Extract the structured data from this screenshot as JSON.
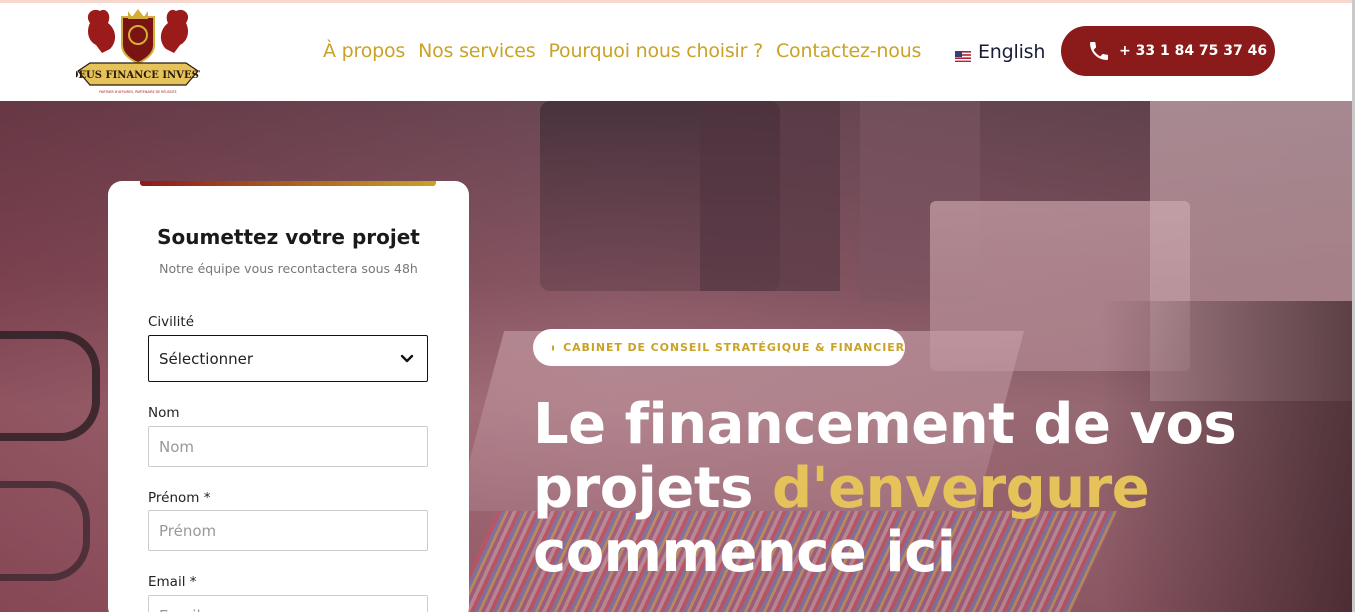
{
  "header": {
    "logo": {
      "text": "DEUS FINANCE INVEST",
      "tagline": "PARTNER D'AFFAIRES, PARTENAIRE DE RÉUSSITE"
    },
    "nav": [
      {
        "label": "À propos"
      },
      {
        "label": "Nos services"
      },
      {
        "label": "Pourquoi nous choisir ?"
      },
      {
        "label": "Contactez-nous"
      }
    ],
    "language": {
      "label": "English",
      "icon": "us-flag-icon"
    },
    "phone": {
      "label": "+ 33 1 84 75 37 46",
      "icon": "phone-icon"
    }
  },
  "form": {
    "title": "Soumettez votre projet",
    "subtitle": "Notre équipe vous recontactera sous 48h",
    "civilite": {
      "label": "Civilité",
      "value": "Sélectionner"
    },
    "nom": {
      "label": "Nom",
      "placeholder": "Nom"
    },
    "prenom": {
      "label": "Prénom *",
      "placeholder": "Prénom"
    },
    "email": {
      "label": "Email *",
      "placeholder": "Email"
    }
  },
  "hero": {
    "badge": "CABINET DE CONSEIL STRATÉGIQUE & FINANCIER",
    "headline_line1": "Le financement de vos",
    "headline_line2_plain": "projets ",
    "headline_line2_accent": "d'envergure",
    "headline_line3": "commence ici"
  },
  "colors": {
    "gold": "#c9a227",
    "burgundy": "#8b1a1a",
    "accent_yellow": "#e5c35a",
    "navy": "#1a1d3a"
  }
}
